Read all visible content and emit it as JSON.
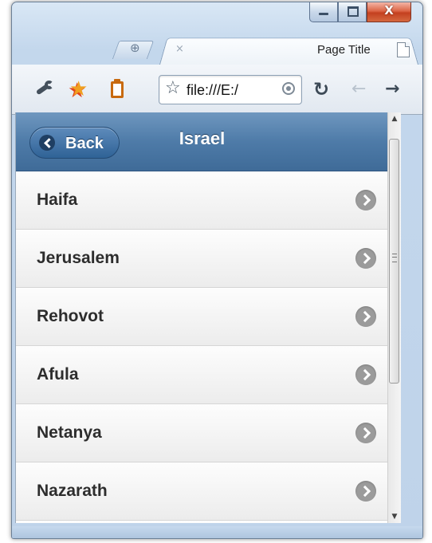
{
  "window": {
    "minimize_icon": "minimize-icon",
    "maximize_icon": "maximize-icon",
    "close_glyph": "X"
  },
  "tabs": {
    "new_tab_glyph": "⊕",
    "active": {
      "title": "Page Title",
      "close_glyph": "×",
      "icon": "page-icon"
    }
  },
  "toolbar": {
    "icons": [
      "wrench-icon",
      "bookmark-star-icon",
      "clipboard-icon"
    ],
    "address": {
      "star_glyph": "☆",
      "url": "file:///E:/"
    },
    "reload_glyph": "↻",
    "back_glyph": "←",
    "forward_glyph": "→"
  },
  "page": {
    "header_color": "#4e7ba8",
    "back_label": "Back",
    "title": "Israel",
    "items": [
      {
        "label": "Haifa"
      },
      {
        "label": "Jerusalem"
      },
      {
        "label": "Rehovot"
      },
      {
        "label": "Afula"
      },
      {
        "label": "Netanya"
      },
      {
        "label": "Nazarath"
      }
    ]
  },
  "scrollbar": {
    "up_glyph": "▲",
    "down_glyph": "▼",
    "position": 0
  }
}
